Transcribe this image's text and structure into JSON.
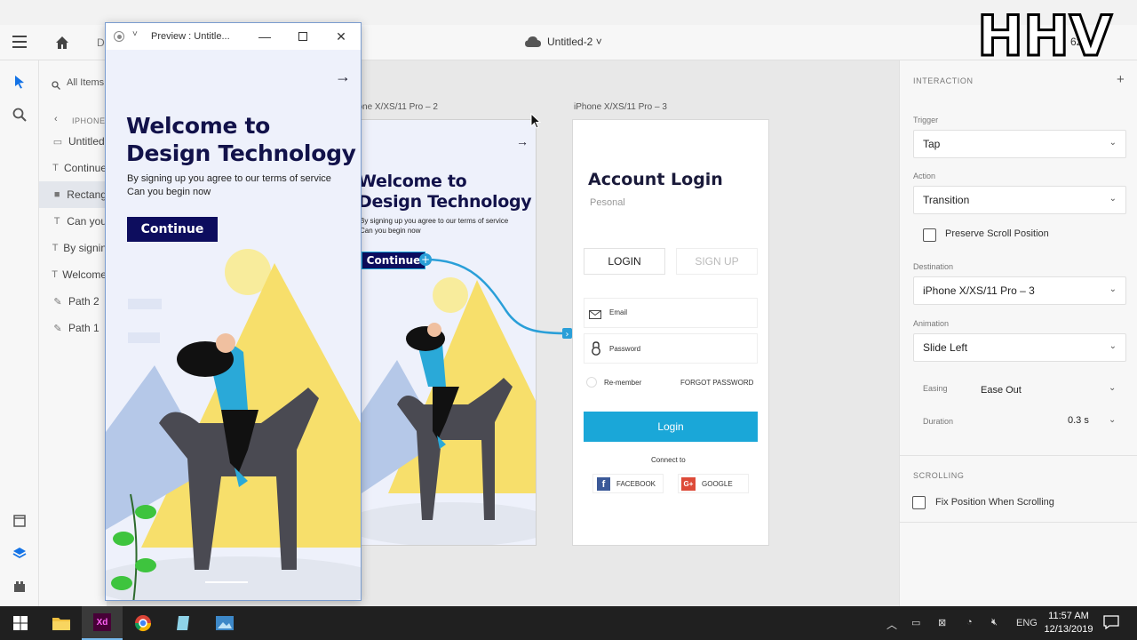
{
  "toolbar": {
    "home_partial": "D",
    "doc_title": "Untitled-2 ˅",
    "zoom_partial": "62.",
    "watermark": "HHV"
  },
  "layers": {
    "search_placeholder": "All Items",
    "group_label": "IPHONE",
    "items": [
      {
        "label": "Untitled",
        "icon": "artboard-icon"
      },
      {
        "label": "Continue",
        "icon": "text-icon"
      },
      {
        "label": "Rectang",
        "icon": "rectangle-icon"
      },
      {
        "label": "Can you",
        "icon": "text-icon"
      },
      {
        "label": "By signin",
        "icon": "text-icon"
      },
      {
        "label": "Welcome",
        "icon": "text-icon"
      },
      {
        "label": "Path 2",
        "icon": "pen-icon"
      },
      {
        "label": "Path 1",
        "icon": "pen-icon"
      }
    ]
  },
  "preview": {
    "window_title": "Preview : Untitle...",
    "title_line1": "Welcome to",
    "title_line2": "Design Technology",
    "sub_line1": "By signing up you agree to our terms of service",
    "sub_line2": "Can you begin now",
    "continue_label": "Continue"
  },
  "artboards": {
    "a2_label": "iPhone X/XS/11 Pro – 2",
    "a2_title_line1": "Welcome to",
    "a2_title_line2": "Design Technology",
    "a2_sub_line1": "By signing up you agree to our terms of service",
    "a2_sub_line2": "Can you begin now",
    "a2_continue": "Continue",
    "a3_label": "iPhone X/XS/11 Pro – 3",
    "login_title": "Account Login",
    "login_sub": "Pesonal",
    "tab_login": "LOGIN",
    "tab_signup": "SIGN UP",
    "email_placeholder": "Email",
    "password_placeholder": "Password",
    "remember": "Re-member",
    "forgot": "FORGOT PASSWORD",
    "login_btn": "Login",
    "connect_to": "Connect to",
    "facebook": "FACEBOOK",
    "google": "GOOGLE"
  },
  "interaction": {
    "header": "INTERACTION",
    "trigger_caption": "Trigger",
    "trigger_value": "Tap",
    "action_caption": "Action",
    "action_value": "Transition",
    "preserve_label": "Preserve Scroll Position",
    "destination_caption": "Destination",
    "destination_value": "iPhone X/XS/11 Pro – 3",
    "animation_caption": "Animation",
    "animation_value": "Slide Left",
    "easing_caption": "Easing",
    "easing_value": "Ease Out",
    "duration_caption": "Duration",
    "duration_value": "0.3 s",
    "scrolling_header": "SCROLLING",
    "fix_position_label": "Fix Position When Scrolling"
  },
  "taskbar": {
    "language": "ENG",
    "time": "11:57 AM",
    "date": "12/13/2019"
  },
  "colors": {
    "accent_blue": "#1aa7d8",
    "navy": "#0d0d5e",
    "wire": "#2a9fd8"
  }
}
